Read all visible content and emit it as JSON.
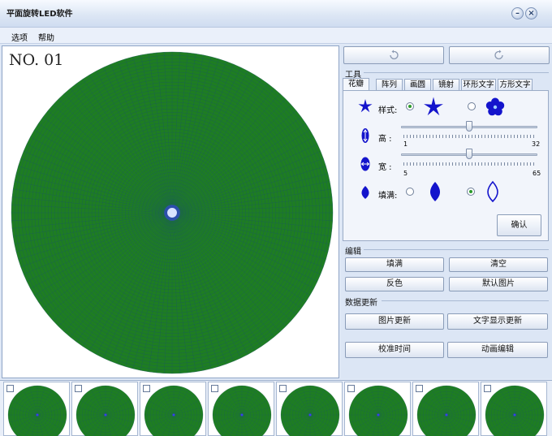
{
  "window": {
    "title": "平面旋转LED软件"
  },
  "menu": {
    "options": "选项",
    "help": "帮助"
  },
  "canvas": {
    "label": "NO. 01",
    "disc_color": "#1e7d22",
    "grid_color": "#1c5e5a",
    "center_color": "#3a3aff"
  },
  "toolbar": {
    "undo_icon": "rotate-left-icon",
    "redo_icon": "rotate-right-icon"
  },
  "tools": {
    "group_title": "工具",
    "tabs": [
      "花瓣",
      "阵列",
      "画圆",
      "镜射",
      "环形文字",
      "方形文字"
    ],
    "style_label": "样式:",
    "height_label": "高 :",
    "height_min": "1",
    "height_max": "32",
    "height_value": 0.5,
    "width_label": "宽 :",
    "width_min": "5",
    "width_max": "65",
    "width_value": 0.5,
    "fill_label": "填满:",
    "confirm": "确认",
    "accent_color": "#1414cc"
  },
  "edit": {
    "group_title": "编辑",
    "fill": "填满",
    "clear": "清空",
    "invert": "反色",
    "default_image": "默认图片"
  },
  "data_update": {
    "group_title": "数据更新",
    "image_update": "图片更新",
    "text_update": "文字显示更新",
    "calibrate_time": "校准时间",
    "animation_edit": "动画编辑"
  }
}
